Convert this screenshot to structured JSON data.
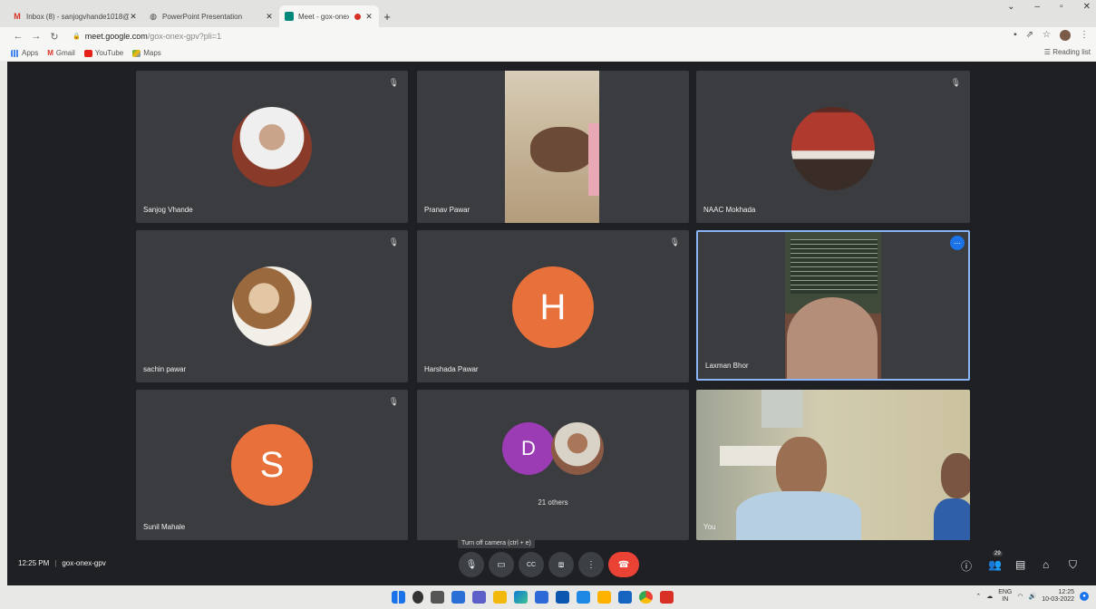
{
  "browser": {
    "tabs": [
      {
        "title": "Inbox (8) - sanjogvhande1018@",
        "icon": "gmail-icon"
      },
      {
        "title": "PowerPoint Presentation",
        "icon": "globe-icon"
      },
      {
        "title": "Meet - gox-onex-gpv",
        "icon": "meet-icon",
        "active": true
      }
    ],
    "new_tab": "+",
    "url_host": "meet.google.com",
    "url_path": "/gox-onex-gpv?pli=1",
    "bookmarks": [
      {
        "label": "Apps",
        "icon": "apps-grid-icon"
      },
      {
        "label": "Gmail",
        "icon": "gmail-icon"
      },
      {
        "label": "YouTube",
        "icon": "youtube-icon"
      },
      {
        "label": "Maps",
        "icon": "maps-icon"
      }
    ],
    "reading_list": "Reading list"
  },
  "meet": {
    "tiles": [
      {
        "name": "Sanjog Vhande"
      },
      {
        "name": "Pranav Pawar"
      },
      {
        "name": "NAAC Mokhada"
      },
      {
        "name": "sachin pawar"
      },
      {
        "name": "Harshada Pawar",
        "initial": "H"
      },
      {
        "name": "Laxman Bhor"
      },
      {
        "name": "Sunil Mahale",
        "initial": "S"
      },
      {
        "name": "",
        "initial": "D",
        "others": "21 others"
      },
      {
        "name": "You"
      }
    ],
    "time": "12:25 PM",
    "meeting_code": "gox-onex-gpv",
    "tooltip": "Turn off camera (ctrl + e)",
    "participants_count": "29",
    "colors": {
      "accent_orange": "#e8703a",
      "accent_purple": "#9b3cb4",
      "end_call": "#ea4335",
      "pin_border": "#8ab4f8"
    }
  },
  "taskbar": {
    "lang_top": "ENG",
    "lang_bottom": "IN",
    "time": "12:25",
    "date": "10-03-2022"
  }
}
